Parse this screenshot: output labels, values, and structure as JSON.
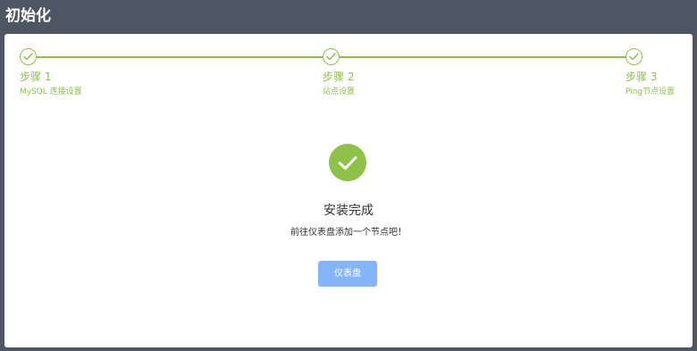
{
  "header": {
    "title": "初始化"
  },
  "steps": [
    {
      "title": "步骤 1",
      "description": "MySQL 连接设置",
      "status": "done"
    },
    {
      "title": "步骤 2",
      "description": "站点设置",
      "status": "done"
    },
    {
      "title": "步骤 3",
      "description": "Ping节点设置",
      "status": "done"
    }
  ],
  "result": {
    "icon": "check-circle-icon",
    "title": "安装完成",
    "subtitle": "前往仪表盘添加一个节点吧！",
    "button_label": "仪表盘"
  },
  "colors": {
    "header_bg": "#4f5663",
    "success": "#8dc148",
    "primary_button": "#84b5fb"
  }
}
